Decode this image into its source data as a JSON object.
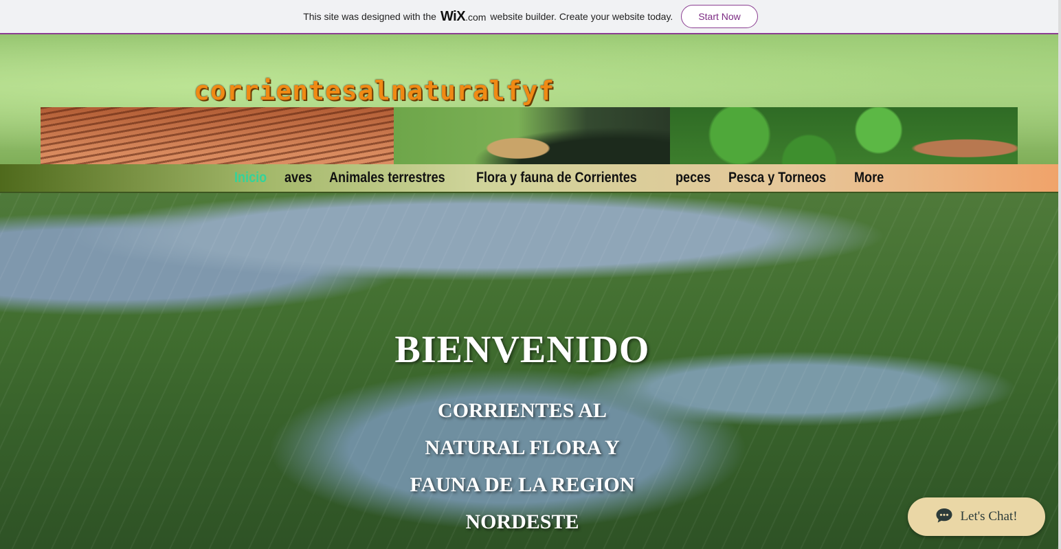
{
  "wix_banner": {
    "text_before": "This site was designed with the",
    "logo": "WiX",
    "dotcom": ".com",
    "text_after": "website builder. Create your website today.",
    "button_label": "Start Now",
    "accent_color": "#8a3d91"
  },
  "header": {
    "site_title": "corrientesalnaturalfyf",
    "title_color": "#f08a14",
    "images": [
      "water-ripples-image",
      "jaguar-image",
      "deer-image"
    ]
  },
  "nav": {
    "items": [
      {
        "label": "Inicio",
        "active": true
      },
      {
        "label": "aves"
      },
      {
        "label": "Animales terrestres"
      },
      {
        "label": "Flora y fauna de Corrientes"
      },
      {
        "label": "peces"
      },
      {
        "label": "Pesca y Torneos"
      },
      {
        "label": "More"
      }
    ],
    "active_color": "#33d39a"
  },
  "hero": {
    "title": "BIENVENIDO",
    "subtitle_lines": [
      "CORRIENTES AL",
      "NATURAL FLORA Y",
      "FAUNA DE LA REGION",
      "NORDESTE"
    ]
  },
  "chat": {
    "label": "Let's Chat!",
    "icon": "chat-bubble-icon",
    "background": "#ead7a6"
  }
}
